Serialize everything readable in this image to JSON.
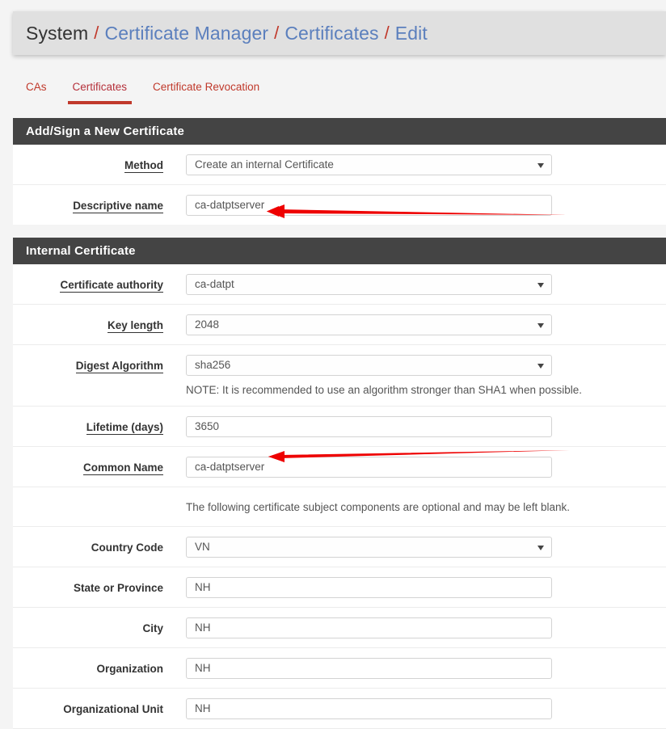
{
  "breadcrumb": {
    "root": "System",
    "separator": "/",
    "items": [
      {
        "label": "Certificate Manager",
        "type": "link"
      },
      {
        "label": "Certificates",
        "type": "link"
      },
      {
        "label": "Edit",
        "type": "link"
      }
    ]
  },
  "tabs": [
    {
      "label": "CAs",
      "active": false
    },
    {
      "label": "Certificates",
      "active": true
    },
    {
      "label": "Certificate Revocation",
      "active": false
    }
  ],
  "sections": {
    "add_sign": {
      "title": "Add/Sign a New Certificate",
      "method": {
        "label": "Method",
        "value": "Create an internal Certificate"
      },
      "descriptive_name": {
        "label": "Descriptive name",
        "value": "ca-datptserver"
      }
    },
    "internal": {
      "title": "Internal Certificate",
      "certificate_authority": {
        "label": "Certificate authority",
        "value": "ca-datpt"
      },
      "key_length": {
        "label": "Key length",
        "value": "2048"
      },
      "digest_algorithm": {
        "label": "Digest Algorithm",
        "value": "sha256",
        "note": "NOTE: It is recommended to use an algorithm stronger than SHA1 when possible."
      },
      "lifetime_days": {
        "label": "Lifetime (days)",
        "value": "3650"
      },
      "common_name": {
        "label": "Common Name",
        "value": "ca-datptserver"
      },
      "optional_note": "The following certificate subject components are optional and may be left blank.",
      "country_code": {
        "label": "Country Code",
        "value": "VN"
      },
      "state_or_province": {
        "label": "State or Province",
        "value": "NH"
      },
      "city": {
        "label": "City",
        "value": "NH"
      },
      "organization": {
        "label": "Organization",
        "value": "NH"
      },
      "organizational_unit": {
        "label": "Organizational Unit",
        "value": "NH"
      }
    }
  },
  "annotations": {
    "arrow_color": "#ee0000",
    "arrows": [
      {
        "name": "descriptive-name-arrow",
        "target": "Descriptive name field"
      },
      {
        "name": "common-name-arrow",
        "target": "Common Name field"
      }
    ]
  },
  "colors": {
    "section_header_bg": "#444444",
    "breadcrumb_bg": "#e0e0e0",
    "tab_accent": "#c0392b",
    "link": "#5b7fbd",
    "page_bg": "#f4f4f4"
  }
}
